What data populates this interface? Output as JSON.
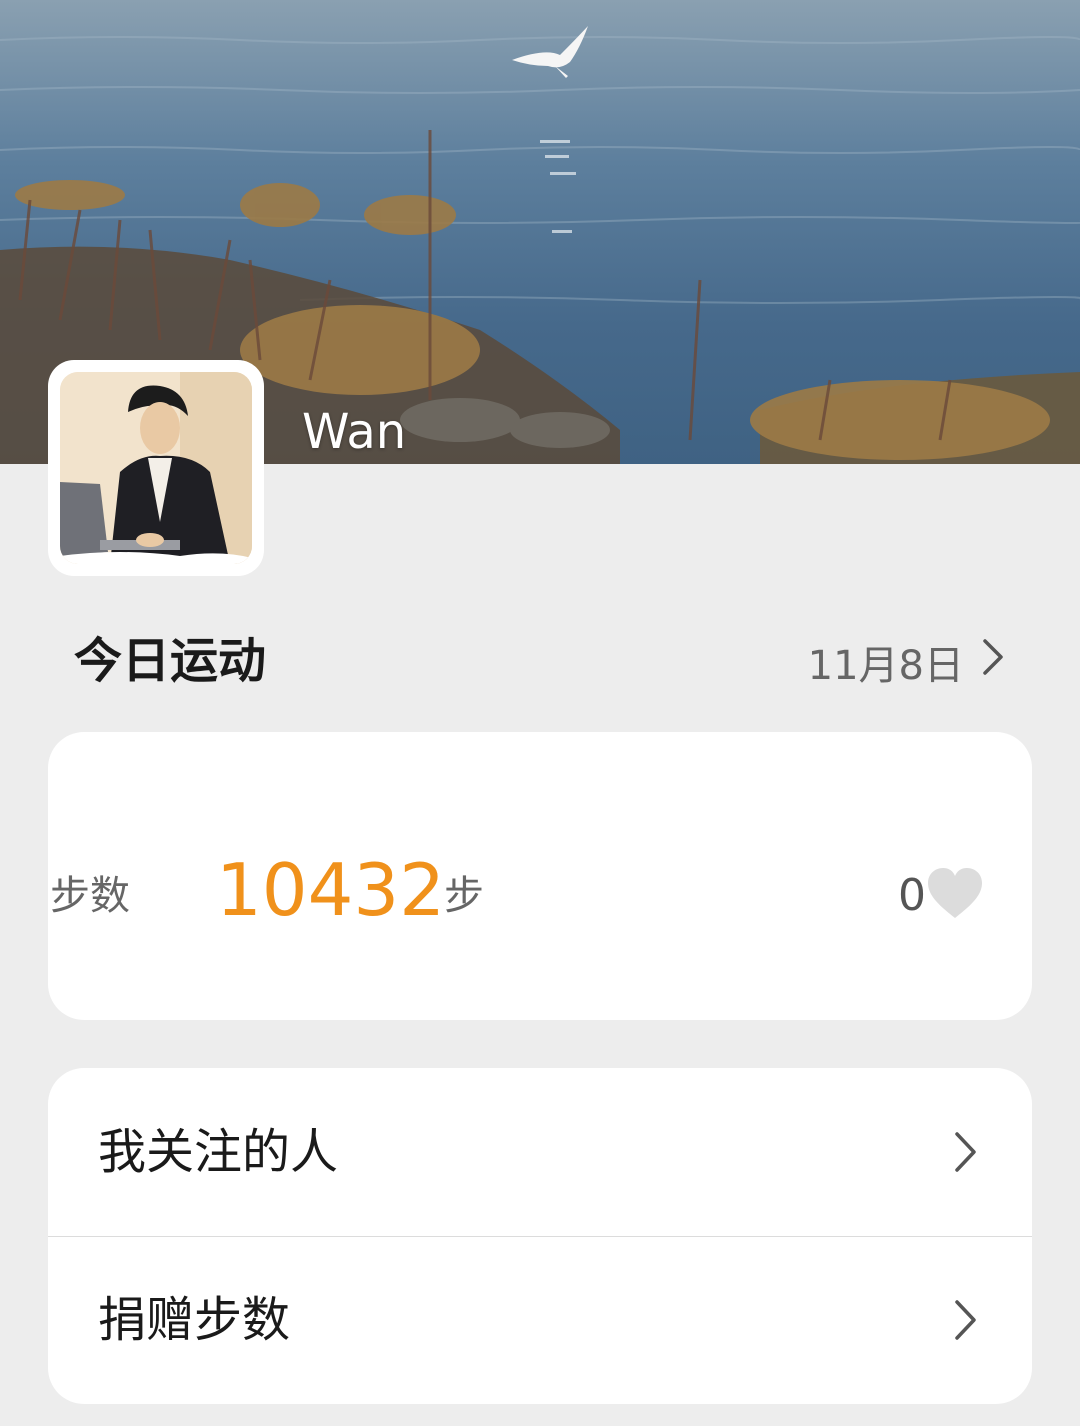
{
  "profile": {
    "username": "Wan"
  },
  "today": {
    "title": "今日运动",
    "date": "11月8日"
  },
  "steps": {
    "label": "步数",
    "value": "10432",
    "unit": "步",
    "likes": "0"
  },
  "menu": {
    "items": [
      {
        "label": "我关注的人"
      },
      {
        "label": "捐赠步数"
      }
    ]
  },
  "colors": {
    "accent": "#f0911b",
    "background": "#ededed"
  },
  "icons": {
    "chevron": "chevron-right-icon",
    "like": "heart-icon"
  }
}
